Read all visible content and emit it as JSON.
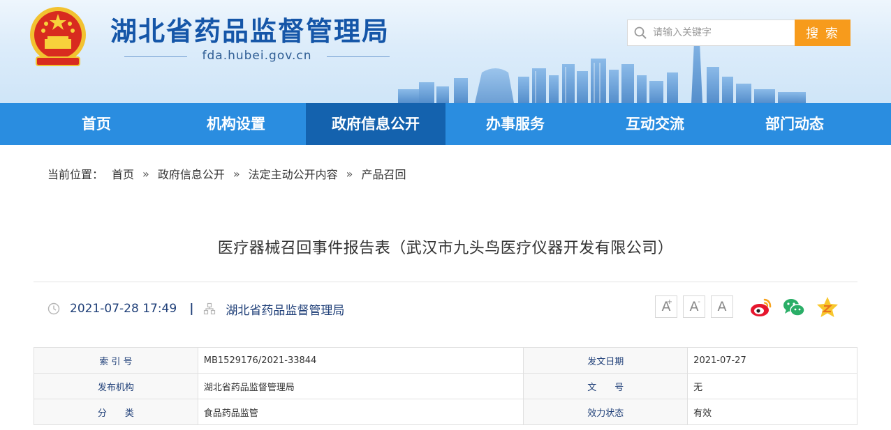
{
  "header": {
    "site_title": "湖北省药品监督管理局",
    "domain": "fda.hubei.gov.cn",
    "emblem_icon": "national-emblem-icon",
    "search": {
      "placeholder": "请输入关键字",
      "value": "",
      "button_label": "搜 索"
    },
    "colors": {
      "title": "#1556a8",
      "search_button": "#f79b1c"
    }
  },
  "nav": {
    "items": [
      {
        "label": "首页"
      },
      {
        "label": "机构设置"
      },
      {
        "label": "政府信息公开",
        "active": true
      },
      {
        "label": "办事服务"
      },
      {
        "label": "互动交流"
      },
      {
        "label": "部门动态"
      }
    ],
    "colors": {
      "bar": "#2a8de0",
      "active": "#1462ae"
    }
  },
  "breadcrumb": {
    "prefix": "当前位置：",
    "separator": "»",
    "items": [
      "首页",
      "政府信息公开",
      "法定主动公开内容",
      "产品召回"
    ]
  },
  "article": {
    "title": "医疗器械召回事件报告表（武汉市九头鸟医疗仪器开发有限公司）",
    "datetime": "2021-07-28 17:49",
    "meta_separator": "|",
    "source": "湖北省药品监督管理局",
    "font_controls": [
      {
        "icon": "font-increase-icon",
        "label": "A",
        "mark": "+"
      },
      {
        "icon": "font-decrease-icon",
        "label": "A",
        "mark": "-"
      },
      {
        "icon": "font-reset-icon",
        "label": "A",
        "mark": ""
      }
    ],
    "share_icons": [
      "weibo-icon",
      "wechat-icon",
      "qzone-icon"
    ]
  },
  "info_table": {
    "rows": [
      [
        {
          "label": "索 引 号",
          "value": "MB1529176/2021-33844"
        },
        {
          "label": "发文日期",
          "value": "2021-07-27"
        }
      ],
      [
        {
          "label": "发布机构",
          "value": "湖北省药品监督管理局"
        },
        {
          "label": "文　　号",
          "value": "无"
        }
      ],
      [
        {
          "label": "分　　类",
          "value": "食品药品监管"
        },
        {
          "label": "效力状态",
          "value": "有效"
        }
      ]
    ]
  }
}
